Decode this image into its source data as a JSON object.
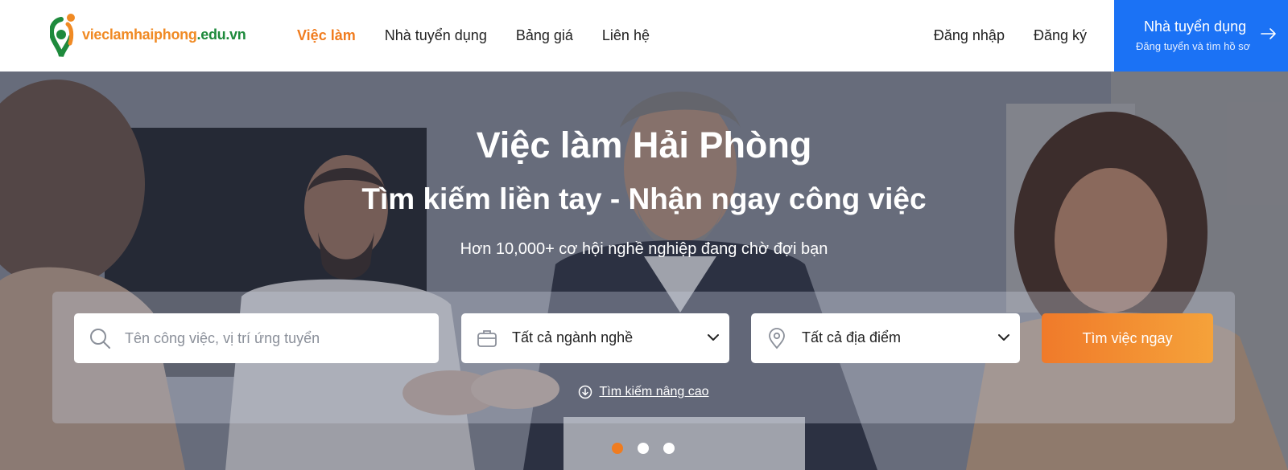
{
  "header": {
    "logo": {
      "part1": "vieclam",
      "part2": "haiphong",
      "part3": ".edu.vn"
    },
    "nav": [
      {
        "label": "Việc làm",
        "active": true
      },
      {
        "label": "Nhà tuyển dụng",
        "active": false
      },
      {
        "label": "Bảng giá",
        "active": false
      },
      {
        "label": "Liên hệ",
        "active": false
      }
    ],
    "login": "Đăng nhập",
    "register": "Đăng ký",
    "employer_cta": {
      "title": "Nhà tuyển dụng",
      "subtitle": "Đăng tuyển và tìm hồ sơ"
    }
  },
  "hero": {
    "title": "Việc làm Hải Phòng",
    "subtitle": "Tìm kiếm liền tay - Nhận ngay công việc",
    "description": "Hơn 10,000+ cơ hội nghề nghiệp đang chờ đợi bạn"
  },
  "search": {
    "keyword_placeholder": "Tên công việc, vị trí ứng tuyển",
    "keyword_value": "",
    "industry_selected": "Tất cả ngành nghề",
    "location_selected": "Tất cả địa điểm",
    "submit_label": "Tìm việc ngay",
    "advanced_label": "Tìm kiếm nâng cao"
  },
  "carousel": {
    "slide_count": 3,
    "active_index": 0
  },
  "colors": {
    "brand_orange": "#f07c1f",
    "brand_blue": "#1b72f5",
    "brand_green": "#1e8a3c"
  },
  "icons": {
    "search": "search-icon",
    "industry": "briefcase-icon",
    "location": "map-pin-icon",
    "dropdown": "chevron-down-icon",
    "advanced": "circle-arrow-down-icon",
    "employer_arrow": "arrow-right-icon"
  }
}
